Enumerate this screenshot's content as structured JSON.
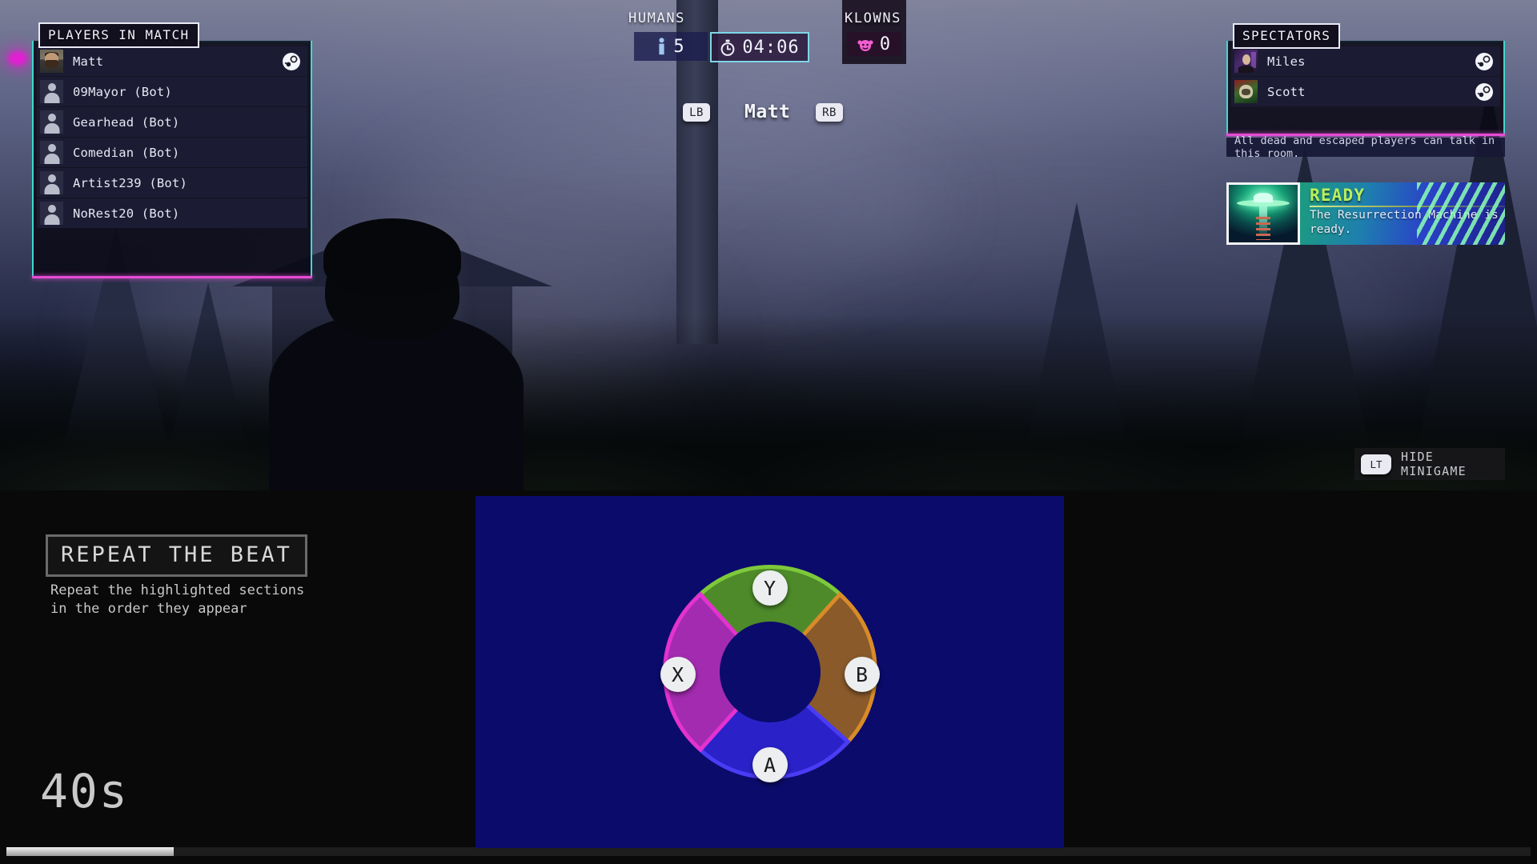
{
  "hud": {
    "players_panel": {
      "title": "PLAYERS IN MATCH",
      "rows": [
        {
          "name": "Matt",
          "avatar": "photo-avatar",
          "platform_icon": "steam-icon",
          "is_bot": false
        },
        {
          "name": "09Mayor (Bot)",
          "avatar": "placeholder-avatar",
          "platform_icon": "",
          "is_bot": true
        },
        {
          "name": "Gearhead (Bot)",
          "avatar": "placeholder-avatar",
          "platform_icon": "",
          "is_bot": true
        },
        {
          "name": "Comedian (Bot)",
          "avatar": "placeholder-avatar",
          "platform_icon": "",
          "is_bot": true
        },
        {
          "name": "Artist239 (Bot)",
          "avatar": "placeholder-avatar",
          "platform_icon": "",
          "is_bot": true
        },
        {
          "name": "NoRest20 (Bot)",
          "avatar": "placeholder-avatar",
          "platform_icon": "",
          "is_bot": true
        }
      ]
    },
    "spectators_panel": {
      "title": "SPECTATORS",
      "rows": [
        {
          "name": "Miles",
          "avatar": "photo-avatar",
          "platform_icon": "steam-icon"
        },
        {
          "name": "Scott",
          "avatar": "photo-avatar",
          "platform_icon": "steam-icon"
        }
      ],
      "note": "All dead and escaped players can talk in this room."
    },
    "humans": {
      "label": "HUMANS",
      "count": "5",
      "icon": "person-icon"
    },
    "klowns": {
      "label": "KLOWNS",
      "count": "0",
      "icon": "klown-face-icon"
    },
    "timer": {
      "value": "04:06",
      "icon": "stopwatch-icon"
    },
    "player_selector": {
      "prev_button": "LB",
      "next_button": "RB",
      "current_name": "Matt"
    },
    "notification": {
      "title": "READY",
      "body": "The Resurrection Machine is ready.",
      "icon": "resurrection-machine-icon",
      "accent_color": "#b9ef5b"
    },
    "hide_minigame": {
      "button": "LT",
      "label": "HIDE MINIGAME"
    }
  },
  "minigame": {
    "title": "REPEAT THE BEAT",
    "description": "Repeat the highlighted sections in the order they appear",
    "timer": "40s",
    "progress_percent": 11,
    "wheel": {
      "background_color": "#0b0b6b",
      "segments": [
        {
          "key": "Y",
          "position": "top",
          "color": "#4e8a2a",
          "rim_color": "#7ec93a",
          "highlighted": true
        },
        {
          "key": "B",
          "position": "right",
          "color": "#8a5a2b",
          "rim_color": "#d98b28",
          "highlighted": false
        },
        {
          "key": "A",
          "position": "bottom",
          "color": "#2a22c8",
          "rim_color": "#4a3cf5",
          "highlighted": false
        },
        {
          "key": "X",
          "position": "left",
          "color": "#a32bb0",
          "rim_color": "#e432d0",
          "highlighted": false
        }
      ]
    }
  },
  "scene": {
    "indicator_icon": "objective-pink-marker"
  }
}
